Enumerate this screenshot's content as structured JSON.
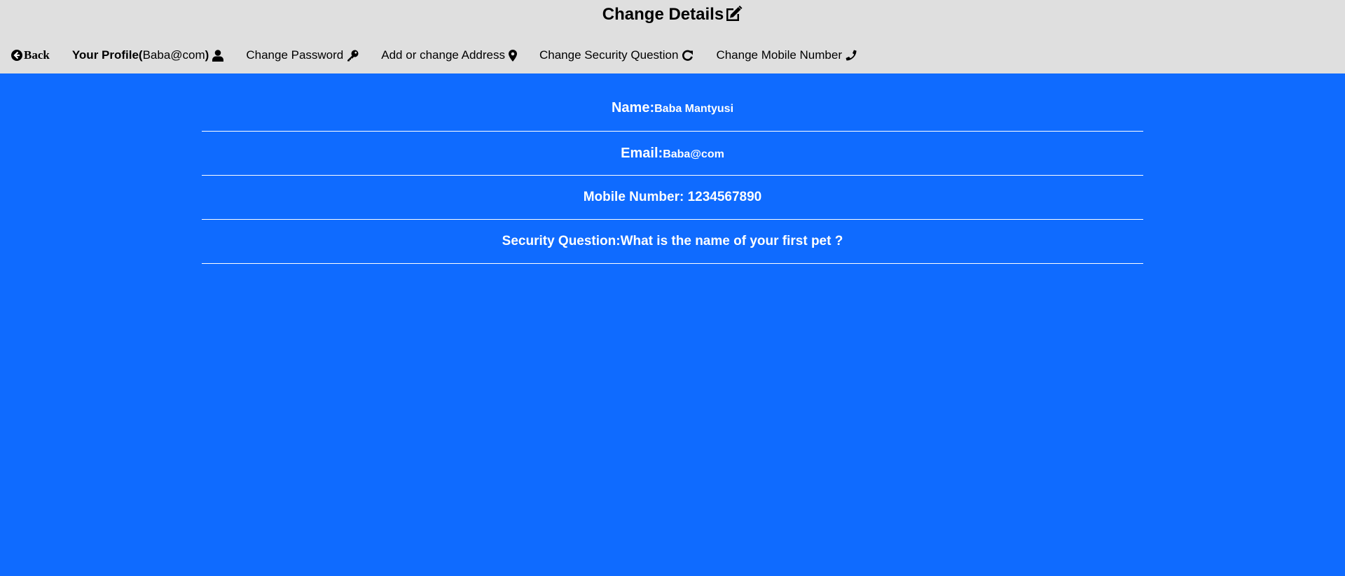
{
  "header": {
    "title": "Change Details",
    "title_icon": "edit-icon"
  },
  "nav": {
    "back_label": "Back",
    "profile_label": "Your Profile(",
    "profile_email": "Baba@com",
    "profile_close": ")",
    "change_password": "Change Password",
    "address": "Add or change Address",
    "security_question": "Change Security Question",
    "mobile_number": "Change Mobile Number"
  },
  "details": {
    "name_label": "Name:",
    "name_value": "Baba Mantyusi",
    "email_label": "Email:",
    "email_value": "Baba@com",
    "mobile_text": "Mobile Number: 1234567890",
    "security_text": "Security Question:What is the name of your first pet ?"
  },
  "colors": {
    "header_bg": "#dfdfdf",
    "body_bg": "#0f6bff",
    "text_on_blue": "#ffffff"
  }
}
